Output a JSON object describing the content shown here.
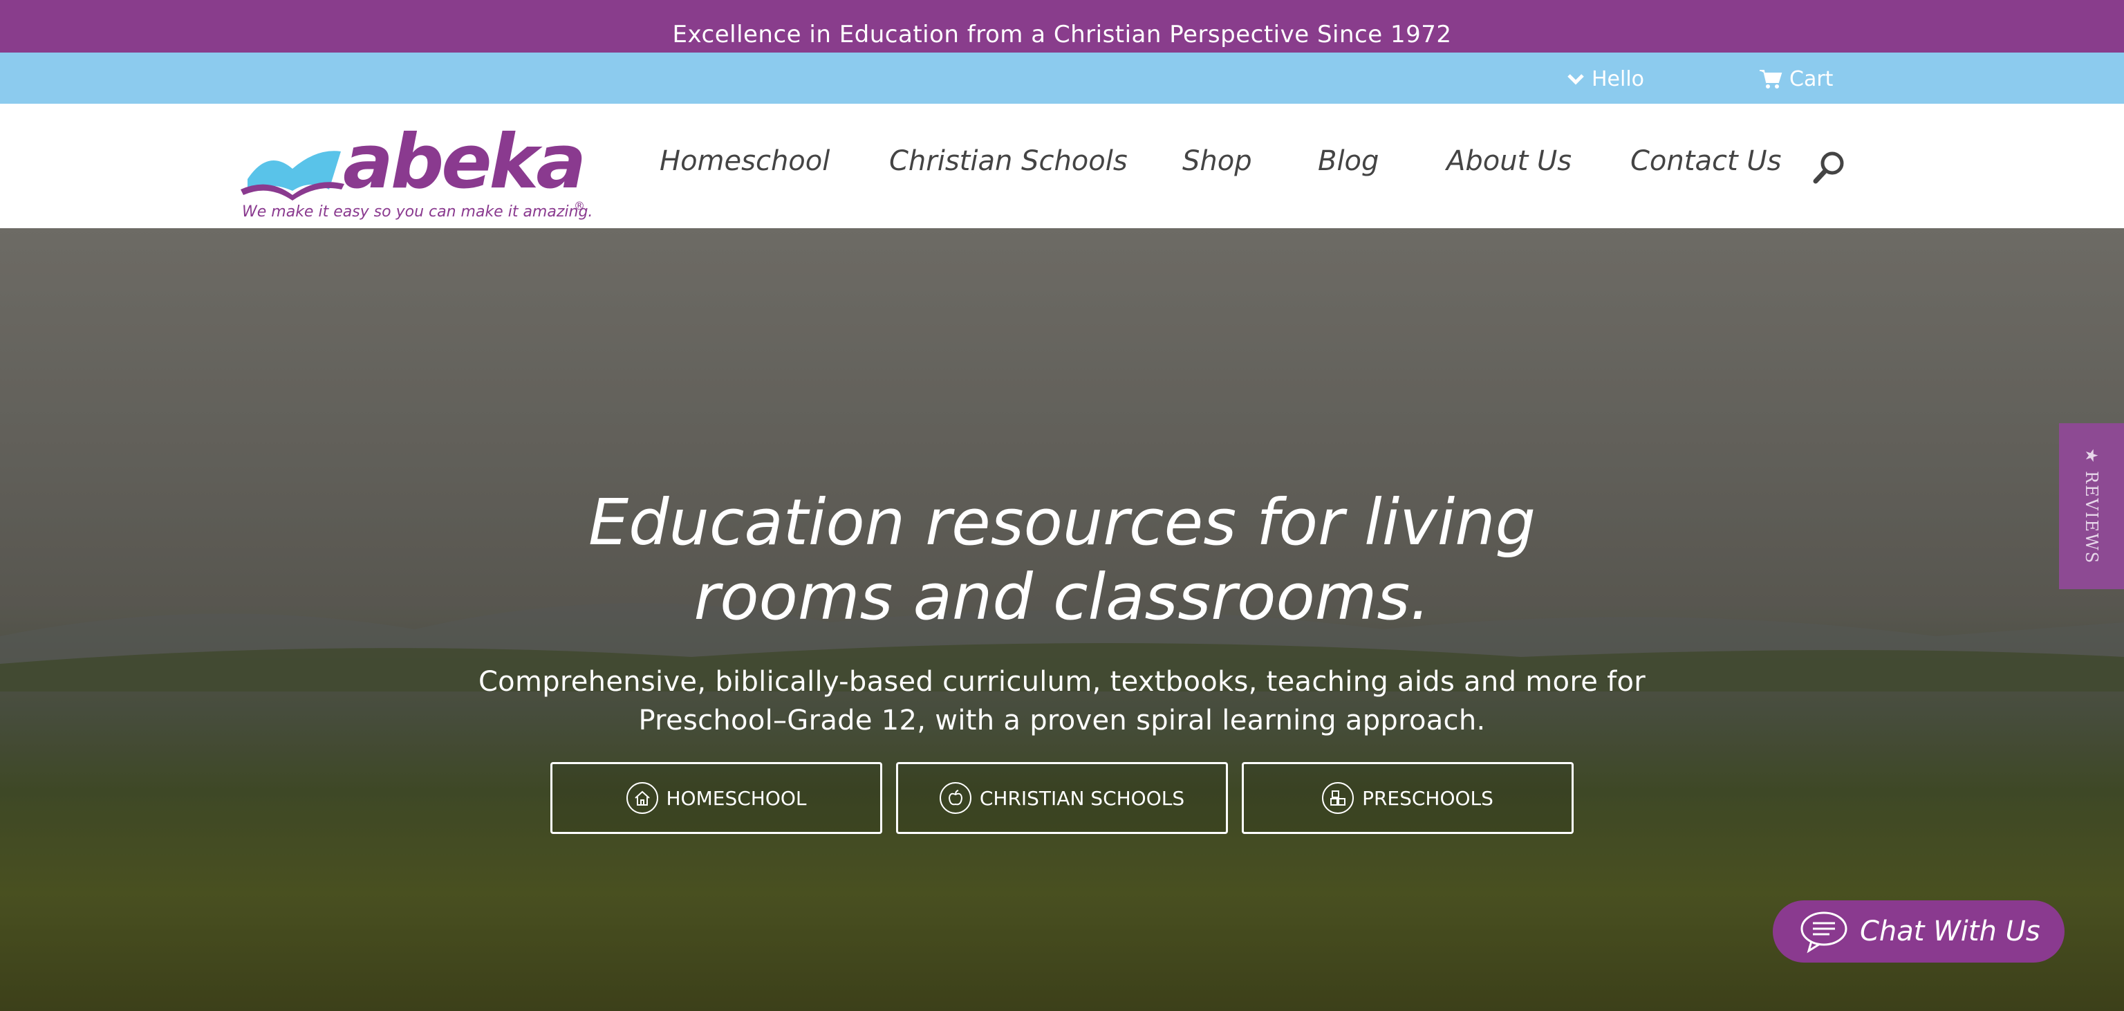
{
  "announcement": "Excellence in Education from a Christian Perspective Since 1972",
  "utility": {
    "hello_label": "Hello",
    "cart_label": "Cart"
  },
  "logo": {
    "wordmark": "abeka",
    "registered": "®",
    "tagline": "We make it easy so you can make it amazing."
  },
  "nav": {
    "items": [
      {
        "label": "Homeschool"
      },
      {
        "label": "Christian Schools"
      },
      {
        "label": "Shop"
      },
      {
        "label": "Blog"
      },
      {
        "label": "About Us"
      },
      {
        "label": "Contact Us"
      }
    ]
  },
  "hero": {
    "title_line1": "Education resources for living",
    "title_line2": "rooms and classrooms.",
    "subtitle_line1": "Comprehensive, biblically-based curriculum, textbooks, teaching aids and more for",
    "subtitle_line2": "Preschool–Grade 12, with a proven spiral learning approach.",
    "buttons": [
      {
        "label": "HOMESCHOOL",
        "icon": "house-icon"
      },
      {
        "label": "CHRISTIAN SCHOOLS",
        "icon": "apple-icon"
      },
      {
        "label": "PRESCHOOLS",
        "icon": "blocks-icon"
      }
    ]
  },
  "reviews_tab": "★ REVIEWS",
  "chat": {
    "label": "Chat With Us"
  },
  "colors": {
    "brand_purple": "#893d8c",
    "utility_blue": "#8ccbee",
    "logo_blue": "#59c3e9",
    "nav_text": "#444444"
  }
}
